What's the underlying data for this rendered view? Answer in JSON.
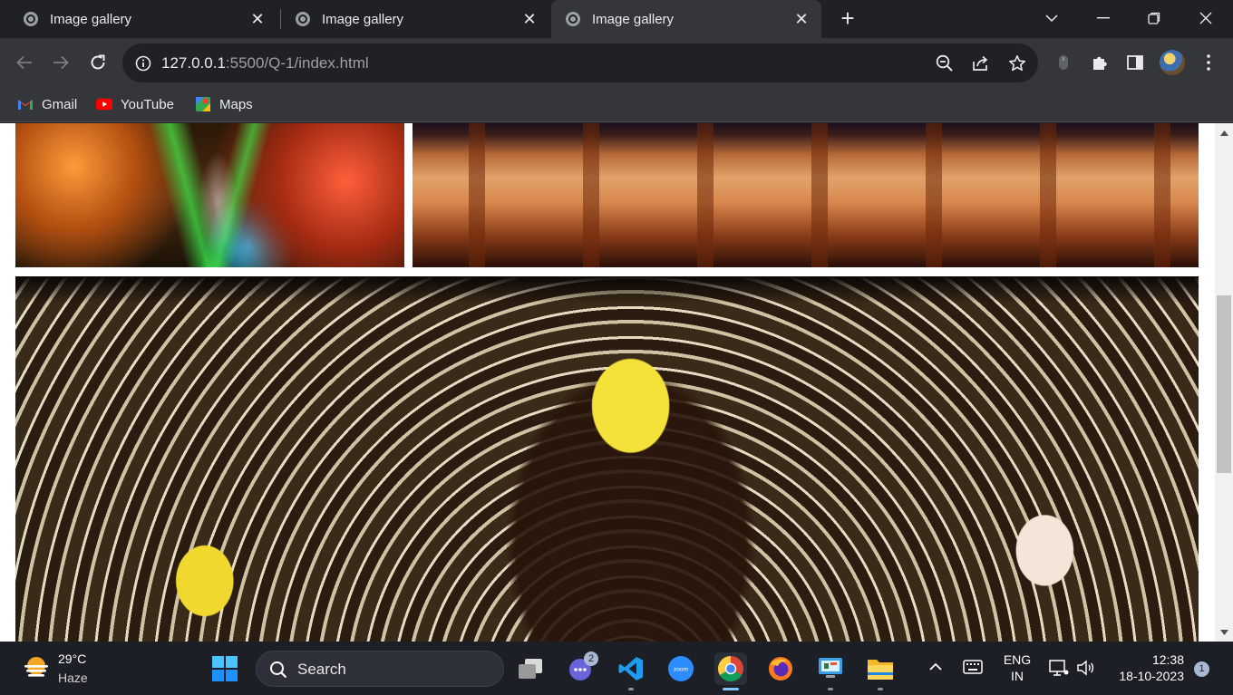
{
  "browser": {
    "tabs": [
      {
        "title": "Image gallery",
        "active": false
      },
      {
        "title": "Image gallery",
        "active": false
      },
      {
        "title": "Image gallery",
        "active": true
      }
    ],
    "url_host": "127.0.0.1",
    "url_rest": ":5500/Q-1/index.html",
    "bookmarks": [
      {
        "label": "Gmail",
        "icon": "gmail-icon"
      },
      {
        "label": "YouTube",
        "icon": "youtube-icon"
      },
      {
        "label": "Maps",
        "icon": "maps-icon"
      }
    ]
  },
  "page": {
    "images": [
      {
        "name": "festival-lights-aerial",
        "icon": "photo"
      },
      {
        "name": "illuminated-temple-pandal",
        "icon": "photo"
      },
      {
        "name": "durga-idol",
        "icon": "photo"
      }
    ]
  },
  "taskbar": {
    "weather": {
      "temp": "29°C",
      "condition": "Haze"
    },
    "search_label": "Search",
    "chat_badge": "2",
    "language_line1": "ENG",
    "language_line2": "IN",
    "time": "12:38",
    "date": "18-10-2023",
    "notification_count": "1"
  },
  "colors": {
    "tabstrip_bg": "#202124",
    "toolbar_bg": "#35363a",
    "taskbar_bg": "#1c1f26",
    "accent": "#7fc6ff"
  }
}
